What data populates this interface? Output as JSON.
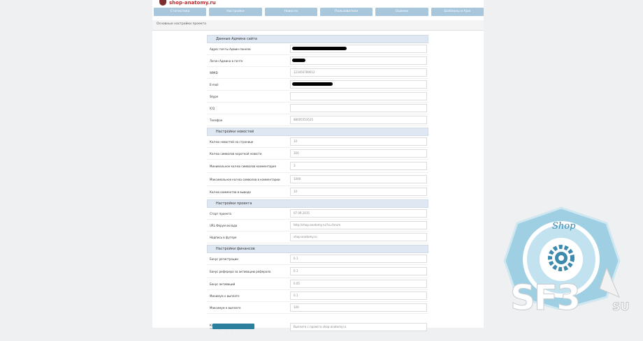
{
  "logo": {
    "text": "shop-anatomy.ru"
  },
  "nav": [
    "Статистика",
    "Настройки",
    "Новости",
    "Пользователи",
    "Оценки",
    "Шаблоны и Ajax"
  ],
  "breadcrumb": "Основные настройки проекта",
  "sections": [
    {
      "title": "Данные Админа сайта",
      "rows": [
        {
          "label": "Адрес почты Админ-панели",
          "value": "",
          "redacted": true,
          "redact_fraction": 0.4
        },
        {
          "label": "Логин Админа в почте",
          "value": "",
          "redacted": true,
          "redact_fraction": 0.1
        },
        {
          "label": "WMID",
          "value": "123456789012"
        },
        {
          "label": "E-mail",
          "value": "",
          "redacted": true,
          "redact_fraction": 0.3
        },
        {
          "label": "Skype",
          "value": ""
        },
        {
          "label": "ICQ",
          "value": ""
        },
        {
          "label": "Телефон",
          "value": "88005553535"
        }
      ]
    },
    {
      "title": "Настройки новостей",
      "rows": [
        {
          "label": "Кол-во новостей на странице",
          "value": "10"
        },
        {
          "label": "Кол-во символов короткой новости",
          "value": "300"
        },
        {
          "label": "Минимальное кол-во символов комментария",
          "value": "3"
        },
        {
          "label": "Максимальное кол-во символов в комментарии",
          "value": "1000"
        },
        {
          "label": "Кол-во комментов в выводе",
          "value": "10"
        }
      ]
    },
    {
      "title": "Настройки проекта",
      "rows": [
        {
          "label": "Старт проекта",
          "value": "07.09.2015"
        },
        {
          "label": "URL Форум вклада",
          "value": "http://shop-anatomy.ru/?a=forum"
        },
        {
          "label": "Надпись в футере",
          "value": "shop-anatomy.ru"
        }
      ]
    },
    {
      "title": "Настройки финансов",
      "rows": [
        {
          "label": "Бонус регистрации",
          "value": "0.1"
        },
        {
          "label": "Бонус реферера за активацию реферала",
          "value": "0.1"
        },
        {
          "label": "Бонус активаций",
          "value": "0.05"
        },
        {
          "label": "Минимум к выплате",
          "value": "0.1"
        },
        {
          "label": "Максимум к выплате",
          "value": "100"
        },
        {
          "label": "Комментарий к выплате",
          "sub": "(максимум 1 строка)",
          "value": "Выплата с проекта shop-anatomy.ru",
          "textarea": true
        }
      ]
    }
  ],
  "submit_label": "",
  "watermark": {
    "text": "SF3",
    "suffix": "SU",
    "ring_text": "Shop"
  }
}
